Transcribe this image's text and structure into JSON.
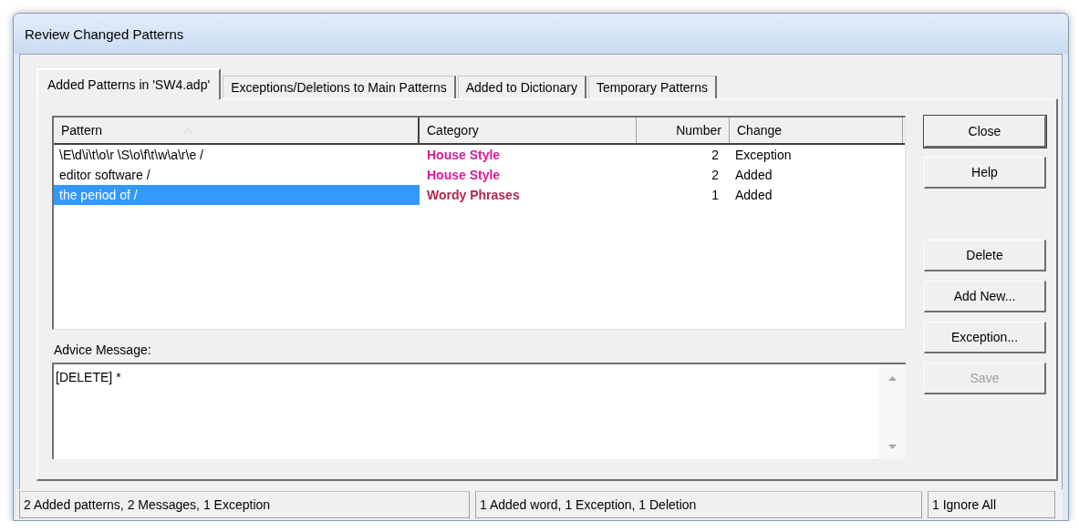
{
  "window": {
    "title": "Review Changed Patterns"
  },
  "tabs": [
    {
      "label": "Added Patterns in 'SW4.adp'",
      "selected": true
    },
    {
      "label": "Exceptions/Deletions to Main Patterns",
      "selected": false
    },
    {
      "label": "Added to Dictionary",
      "selected": false
    },
    {
      "label": "Temporary Patterns",
      "selected": false
    }
  ],
  "table": {
    "columns": [
      "Pattern",
      "Category",
      "Number",
      "Change"
    ],
    "rows": [
      {
        "pattern": "\\E\\d\\i\\t\\o\\r \\S\\o\\f\\t\\w\\a\\r\\e /",
        "category": "House Style",
        "color": "#d81b9a",
        "number": "2",
        "change": "Exception",
        "selected": false
      },
      {
        "pattern": "editor software /",
        "category": "House Style",
        "color": "#d81b9a",
        "number": "2",
        "change": "Added",
        "selected": false
      },
      {
        "pattern": "the period of /",
        "category": "Wordy Phrases",
        "color": "#b3264b",
        "number": "1",
        "change": "Added",
        "selected": true
      }
    ]
  },
  "advice": {
    "label": "Advice Message:",
    "value": "[DELETE] *"
  },
  "buttons": [
    {
      "label": "Close",
      "disabled": false,
      "gap_before": false
    },
    {
      "label": "Help",
      "disabled": false,
      "gap_before": false
    },
    {
      "label": "Delete",
      "disabled": false,
      "gap_before": true
    },
    {
      "label": "Add New...",
      "disabled": false,
      "gap_before": false
    },
    {
      "label": "Exception...",
      "disabled": false,
      "gap_before": false
    },
    {
      "label": "Save",
      "disabled": true,
      "gap_before": false
    }
  ],
  "status_bar": [
    "2 Added patterns, 2 Messages, 1 Exception",
    "1 Added word, 1 Exception, 1 Deletion",
    "1 Ignore All"
  ]
}
